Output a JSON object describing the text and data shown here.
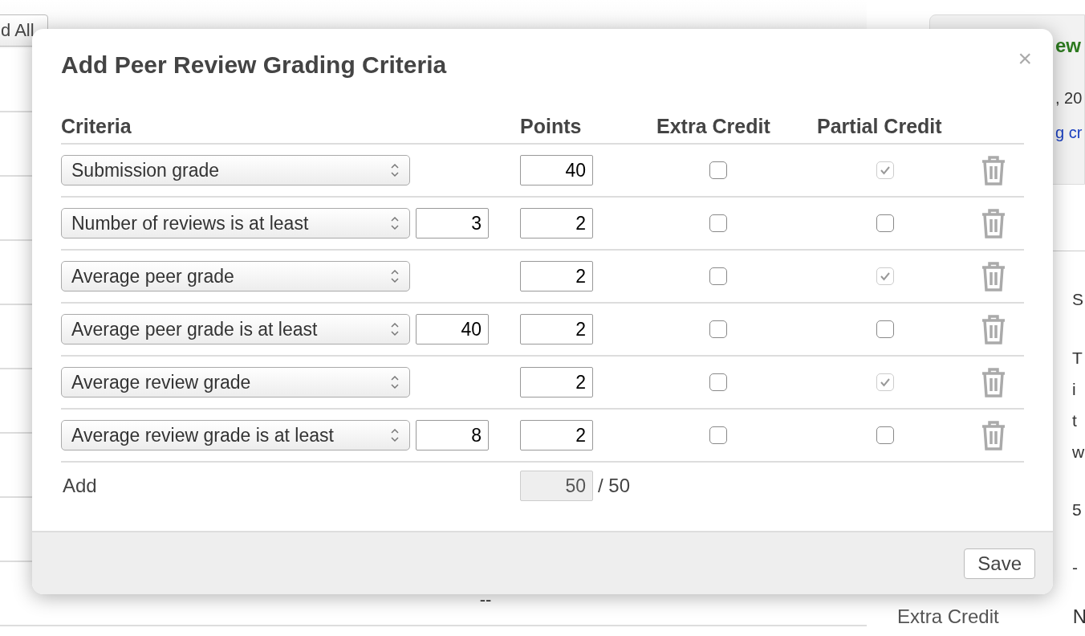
{
  "background": {
    "top_button": "d All",
    "table_cell": "--",
    "side_card": {
      "heading": "ew",
      "date": ", 20",
      "link": "g cr"
    },
    "side_values": [
      "S",
      "T",
      "i",
      "t",
      "w",
      "5",
      "-"
    ],
    "field_label": "Extra Credit",
    "field_value": "N"
  },
  "dialog": {
    "title": "Add Peer Review Grading Criteria",
    "close": "×",
    "columns": [
      "Criteria",
      "Points",
      "Extra Credit",
      "Partial Credit"
    ],
    "rows": [
      {
        "criterion": "Submission grade",
        "points": "40",
        "extra_credit": false,
        "partial_credit": true,
        "partial_disabled": true
      },
      {
        "criterion": "Number of reviews is at least",
        "threshold": "3",
        "points": "2",
        "extra_credit": false,
        "partial_credit": false,
        "partial_disabled": false
      },
      {
        "criterion": "Average peer grade",
        "points": "2",
        "extra_credit": false,
        "partial_credit": true,
        "partial_disabled": true
      },
      {
        "criterion": "Average peer grade is at least",
        "threshold": "40",
        "points": "2",
        "extra_credit": false,
        "partial_credit": false,
        "partial_disabled": false
      },
      {
        "criterion": "Average review grade",
        "points": "2",
        "extra_credit": false,
        "partial_credit": true,
        "partial_disabled": true
      },
      {
        "criterion": "Average review grade is at least",
        "threshold": "8",
        "points": "2",
        "extra_credit": false,
        "partial_credit": false,
        "partial_disabled": false
      }
    ],
    "add": "Add",
    "total": "50",
    "max": "/ 50",
    "save": "Save"
  }
}
